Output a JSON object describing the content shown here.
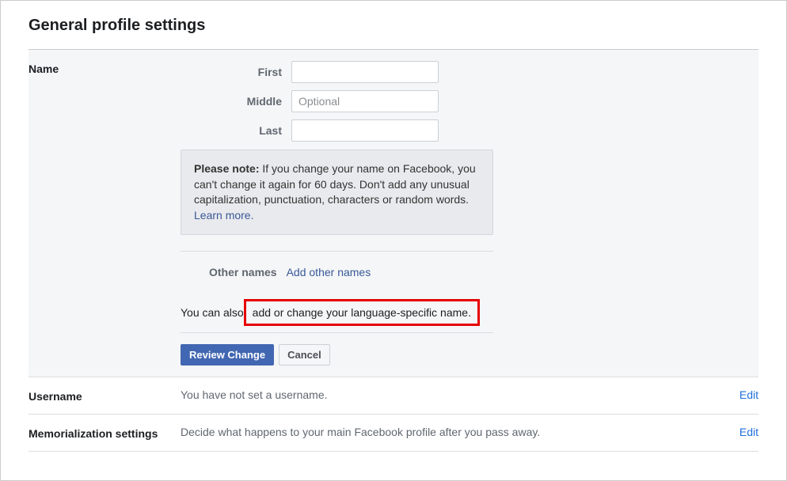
{
  "page": {
    "title": "General profile settings"
  },
  "nameSection": {
    "label": "Name",
    "firstLabel": "First",
    "middleLabel": "Middle",
    "middlePlaceholder": "Optional",
    "lastLabel": "Last",
    "note": {
      "prefix": "Please note:",
      "text": " If you change your name on Facebook, you can't change it again for 60 days. Don't add any unusual capitalization, punctuation, characters or random words. ",
      "learnMore": "Learn more."
    },
    "otherNamesLabel": "Other names",
    "addOtherNames": "Add other names",
    "langSpecificPrefix": "You can also",
    "langSpecificLink": "add or change your language-specific name.",
    "reviewButton": "Review Change",
    "cancelButton": "Cancel"
  },
  "usernameSection": {
    "label": "Username",
    "text": "You have not set a username.",
    "editLink": "Edit"
  },
  "memorializationSection": {
    "label": "Memorialization settings",
    "text": "Decide what happens to your main Facebook profile after you pass away.",
    "editLink": "Edit"
  }
}
